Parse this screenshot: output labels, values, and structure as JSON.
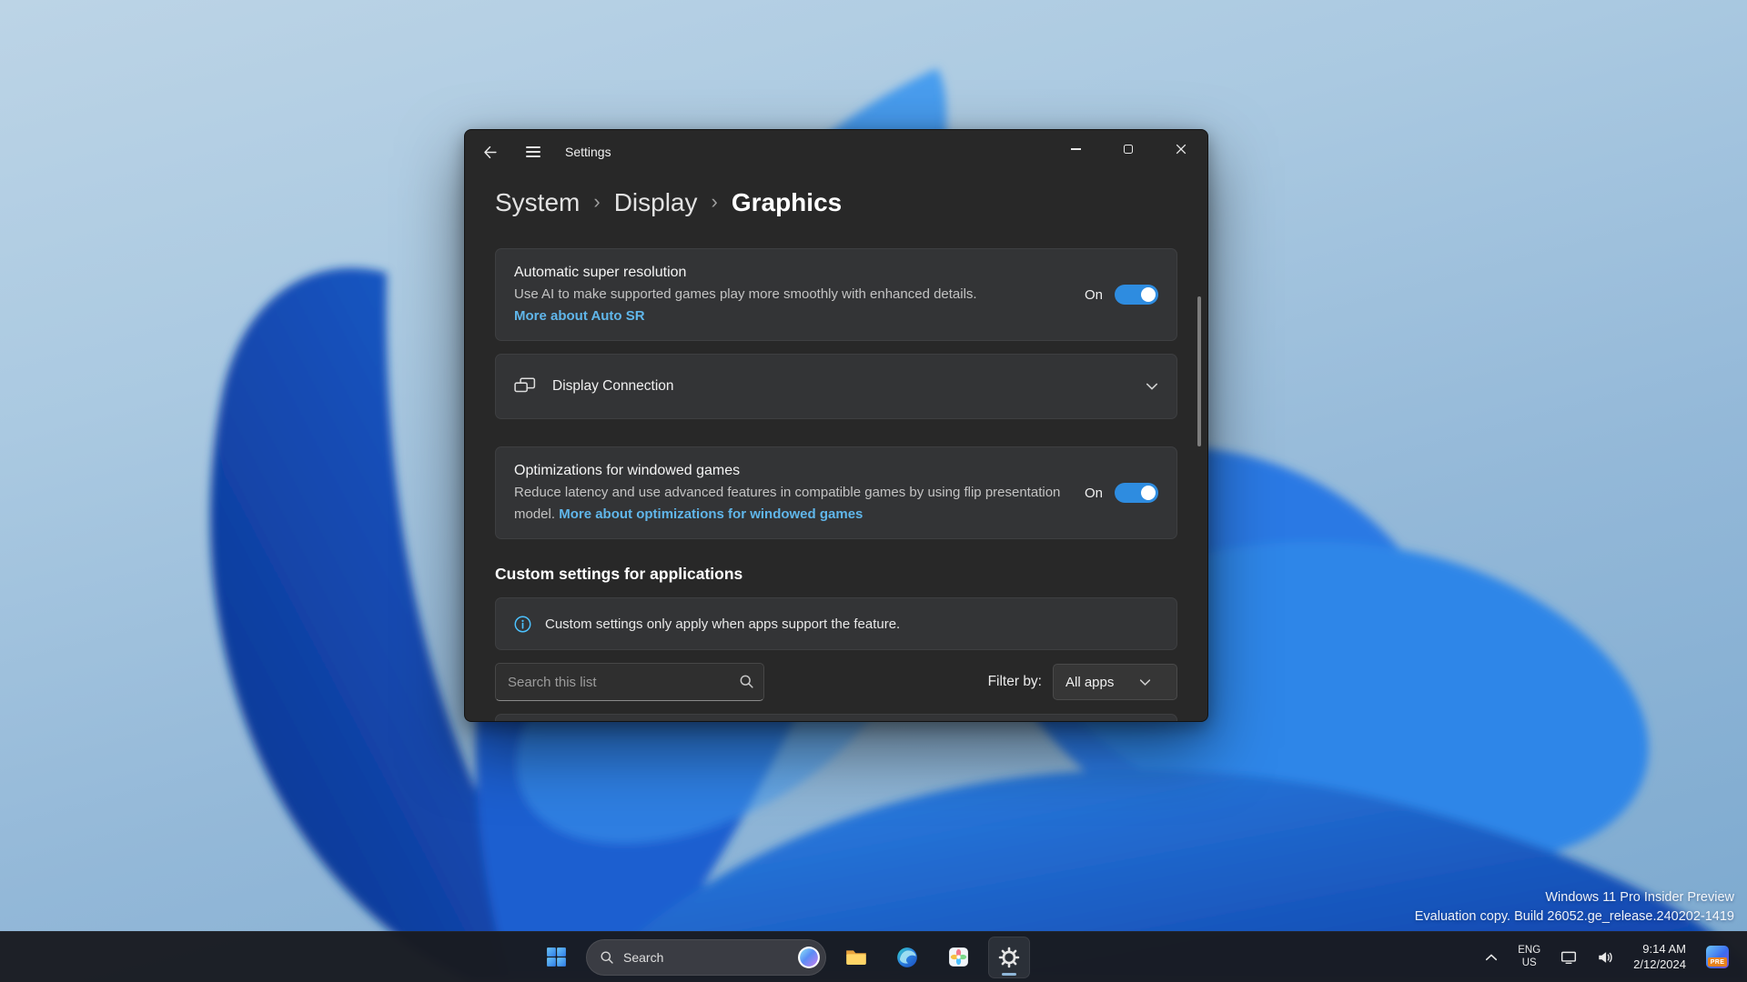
{
  "colors": {
    "accent": "#2e8ce0",
    "link": "#60b6ea",
    "info": "#4cc2ff"
  },
  "window": {
    "title": "Settings",
    "breadcrumb": {
      "separator": "›",
      "items": [
        "System",
        "Display",
        "Graphics"
      ]
    },
    "auto_sr": {
      "title": "Automatic super resolution",
      "description": "Use AI to make supported games play more smoothly with enhanced details.",
      "link": "More about Auto SR",
      "state": "On"
    },
    "display_connection": {
      "title": "Display Connection"
    },
    "windowed_games": {
      "title": "Optimizations for windowed games",
      "description": "Reduce latency and use advanced features in compatible games by using flip presentation model.",
      "link": "More about optimizations for windowed games",
      "state": "On"
    },
    "custom_section": {
      "heading": "Custom settings for applications",
      "info_text": "Custom settings only apply when apps support the feature.",
      "search_placeholder": "Search this list",
      "filter_label": "Filter by:",
      "filter_value": "All apps"
    }
  },
  "taskbar": {
    "search_label": "Search"
  },
  "tray": {
    "language": "ENG",
    "region": "US",
    "time": "9:14 AM",
    "date": "2/12/2024",
    "preview_badge": "PRE"
  },
  "watermark": {
    "line1": "Windows 11 Pro Insider Preview",
    "line2": "Evaluation copy. Build 26052.ge_release.240202-1419"
  }
}
